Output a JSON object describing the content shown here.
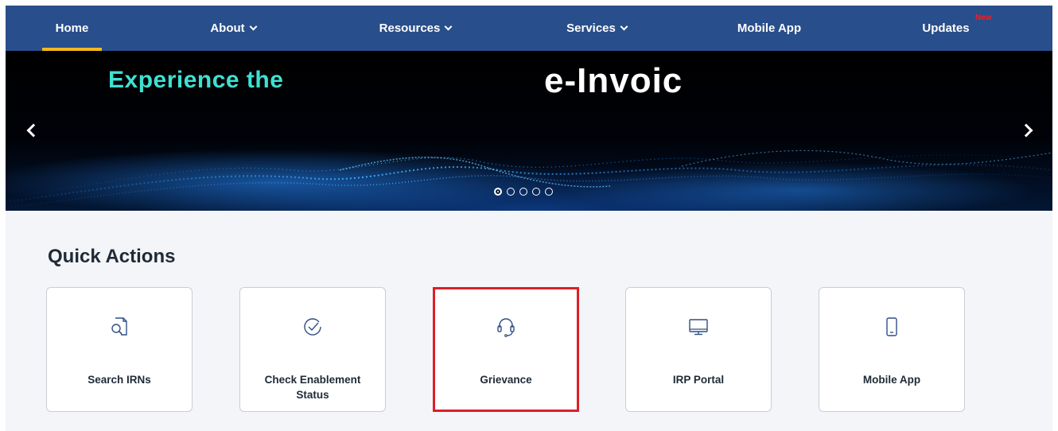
{
  "nav": {
    "items": [
      {
        "label": "Home",
        "dropdown": false,
        "active": true
      },
      {
        "label": "About",
        "dropdown": true
      },
      {
        "label": "Resources",
        "dropdown": true
      },
      {
        "label": "Services",
        "dropdown": true
      },
      {
        "label": "Mobile App",
        "dropdown": false
      },
      {
        "label": "Updates",
        "dropdown": false
      }
    ],
    "new_badge": "New",
    "colors": {
      "background": "#284e8b",
      "active_underline": "#f2b81f"
    }
  },
  "banner": {
    "headline_left": "Experience the",
    "headline_right": "e-Invoic",
    "prev_icon": "chevron-left-icon",
    "next_icon": "chevron-right-icon",
    "slide_count": 5,
    "active_slide": 1,
    "colors": {
      "headline_left": "#3fe0d2",
      "headline_right": "#ffffff"
    }
  },
  "quick_actions": {
    "title": "Quick Actions",
    "items": [
      {
        "label": "Search IRNs",
        "icon": "search-document-icon"
      },
      {
        "label": "Check Enablement Status",
        "icon": "check-circle-icon"
      },
      {
        "label": "Grievance",
        "icon": "headset-icon",
        "highlighted": true
      },
      {
        "label": "IRP Portal",
        "icon": "monitor-icon"
      },
      {
        "label": "Mobile App",
        "icon": "smartphone-icon"
      }
    ],
    "colors": {
      "icon": "#2e4f86",
      "highlight_border": "#dc1f26"
    }
  }
}
